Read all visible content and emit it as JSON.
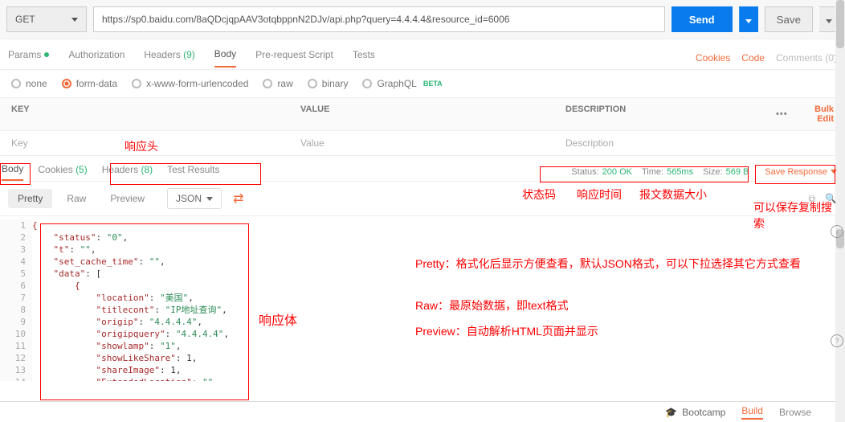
{
  "request": {
    "method": "GET",
    "url": "https://sp0.baidu.com/8aQDcjqpAAV3otqbppnN2DJv/api.php?query=4.4.4.4&resource_id=6006",
    "send_label": "Send",
    "save_label": "Save"
  },
  "req_tabs": {
    "params": "Params",
    "auth": "Authorization",
    "headers": "Headers",
    "headers_count": "(9)",
    "body": "Body",
    "prereq": "Pre-request Script",
    "tests": "Tests"
  },
  "right_links": {
    "cookies": "Cookies",
    "code": "Code",
    "comments": "Comments (0)"
  },
  "body_types": {
    "none": "none",
    "form": "form-data",
    "urlenc": "x-www-form-urlencoded",
    "raw": "raw",
    "binary": "binary",
    "graphql": "GraphQL",
    "beta": "BETA"
  },
  "kv": {
    "key_h": "KEY",
    "val_h": "VALUE",
    "desc_h": "DESCRIPTION",
    "key_ph": "Key",
    "val_ph": "Value",
    "desc_ph": "Description",
    "bulk": "Bulk Edit"
  },
  "resp_tabs": {
    "body": "Body",
    "cookies": "Cookies",
    "cookies_count": "(5)",
    "headers": "Headers",
    "headers_count": "(8)",
    "tests": "Test Results"
  },
  "status": {
    "status_lbl": "Status:",
    "status_val": "200 OK",
    "time_lbl": "Time:",
    "time_val": "565ms",
    "size_lbl": "Size:",
    "size_val": "569 B",
    "save_resp": "Save Response"
  },
  "view": {
    "pretty": "Pretty",
    "raw": "Raw",
    "preview": "Preview",
    "fmt": "JSON"
  },
  "code_lines": [
    "{",
    "    \"status\": \"0\",",
    "    \"t\": \"\",",
    "    \"set_cache_time\": \"\",",
    "    \"data\": [",
    "        {",
    "            \"location\": \"美国\",",
    "            \"titlecont\": \"IP地址查询\",",
    "            \"origip\": \"4.4.4.4\",",
    "            \"origipquery\": \"4.4.4.4\",",
    "            \"showlamp\": \"1\",",
    "            \"showLikeShare\": 1,",
    "            \"shareImage\": 1,",
    "            \"ExtendedLocation\": \"\","
  ],
  "annotations": {
    "resp_head": "响应头",
    "status_code": "状态码",
    "resp_time": "响应时间",
    "msg_size": "报文数据大小",
    "save_note": "可以保存复制搜索",
    "pretty_note": "Pretty：格式化后显示方便查看，默认JSON格式，可以下拉选择其它方式查看",
    "raw_note": "Raw：最原始数据，即text格式",
    "preview_note": "Preview：自动解析HTML页面并显示",
    "resp_body": "响应体"
  },
  "bottom": {
    "bootcamp": "Bootcamp",
    "build": "Build",
    "browse": "Browse"
  }
}
